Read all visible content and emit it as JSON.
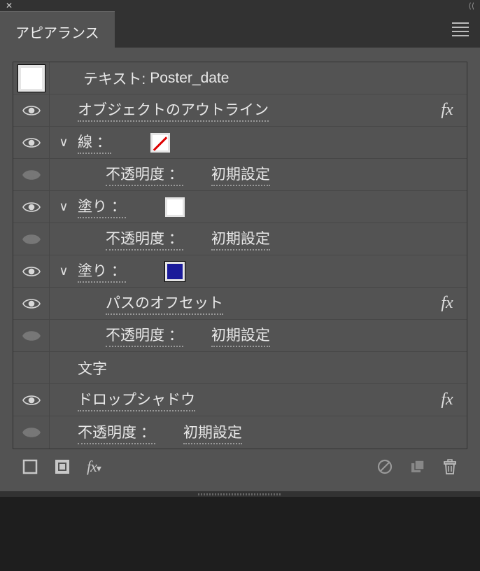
{
  "panel": {
    "tab_label": "アピアランス",
    "object_title_prefix": "テキスト: ",
    "object_title_name": "Poster_date"
  },
  "rows": {
    "outline_label": "オブジェクトのアウトライン",
    "stroke_label": "線 ：",
    "opacity_label": "不透明度 ：",
    "opacity_value": "初期設定",
    "fill_label": "塗り ：",
    "offset_label": "パスのオフセット",
    "characters_label": "文字",
    "dropshadow_label": "ドロップシャドウ",
    "fx_symbol": "fx"
  },
  "footer": {
    "fx_label": "fx"
  },
  "swatches": {
    "stroke": "none",
    "fill1": "white",
    "fill2": "blue"
  }
}
